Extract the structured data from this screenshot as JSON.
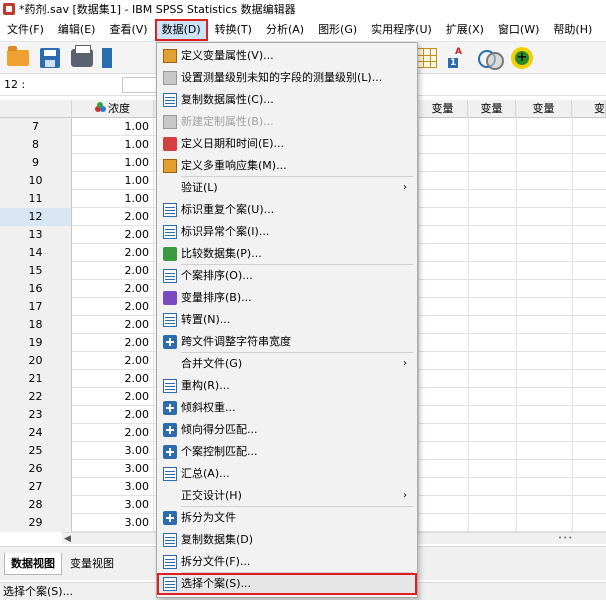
{
  "window": {
    "title": "*药剂.sav [数据集1] - IBM SPSS Statistics 数据编辑器",
    "app_icon": "spss-app-icon"
  },
  "menubar": [
    {
      "label": "文件(F)"
    },
    {
      "label": "编辑(E)"
    },
    {
      "label": "查看(V)"
    },
    {
      "label": "数据(D)",
      "active": true
    },
    {
      "label": "转换(T)"
    },
    {
      "label": "分析(A)"
    },
    {
      "label": "图形(G)"
    },
    {
      "label": "实用程序(U)"
    },
    {
      "label": "扩展(X)"
    },
    {
      "label": "窗口(W)"
    },
    {
      "label": "帮助(H)"
    }
  ],
  "refbar": {
    "label": "12 :",
    "value": ""
  },
  "grid": {
    "variable": "浓度",
    "columns": [
      "变量",
      "变量",
      "变量",
      "变"
    ],
    "selected_row": "12",
    "rows": [
      {
        "n": "7",
        "v": "1.00"
      },
      {
        "n": "8",
        "v": "1.00"
      },
      {
        "n": "9",
        "v": "1.00"
      },
      {
        "n": "10",
        "v": "1.00"
      },
      {
        "n": "11",
        "v": "1.00"
      },
      {
        "n": "12",
        "v": "2.00"
      },
      {
        "n": "13",
        "v": "2.00"
      },
      {
        "n": "14",
        "v": "2.00"
      },
      {
        "n": "15",
        "v": "2.00"
      },
      {
        "n": "16",
        "v": "2.00"
      },
      {
        "n": "17",
        "v": "2.00"
      },
      {
        "n": "18",
        "v": "2.00"
      },
      {
        "n": "19",
        "v": "2.00"
      },
      {
        "n": "20",
        "v": "2.00"
      },
      {
        "n": "21",
        "v": "2.00"
      },
      {
        "n": "22",
        "v": "2.00"
      },
      {
        "n": "23",
        "v": "2.00"
      },
      {
        "n": "24",
        "v": "2.00"
      },
      {
        "n": "25",
        "v": "3.00"
      },
      {
        "n": "26",
        "v": "3.00"
      },
      {
        "n": "27",
        "v": "3.00"
      },
      {
        "n": "28",
        "v": "3.00"
      },
      {
        "n": "29",
        "v": "3.00"
      }
    ]
  },
  "tabs": {
    "data_view": "数据视图",
    "variable_view": "变量视图"
  },
  "status": "选择个案(S)...",
  "data_menu": {
    "items": [
      {
        "label": "定义变量属性(V)...",
        "icon": "define-variable-properties-icon",
        "type": "orange"
      },
      {
        "label": "设置测量级别未知的字段的测量级别(L)...",
        "icon": "measurement-level-icon",
        "type": "gray"
      },
      {
        "label": "复制数据属性(C)...",
        "icon": "copy-data-properties-icon",
        "type": "sheet"
      },
      {
        "label": "新建定制属性(B)...",
        "icon": "custom-attribute-icon",
        "type": "gray",
        "disabled": true
      },
      {
        "label": "定义日期和时间(E)...",
        "icon": "date-time-icon",
        "type": "red"
      },
      {
        "label": "定义多重响应集(M)...",
        "icon": "multiple-response-icon",
        "type": "orange"
      },
      {
        "label": "验证(L)",
        "icon": "",
        "type": "none",
        "submenu": true
      },
      {
        "label": "标识重复个案(U)...",
        "icon": "duplicate-cases-icon",
        "type": "sheet"
      },
      {
        "label": "标识异常个案(I)...",
        "icon": "unusual-cases-icon",
        "type": "sheet"
      },
      {
        "label": "比较数据集(P)...",
        "icon": "compare-datasets-icon",
        "type": "green"
      },
      {
        "label": "个案排序(O)...",
        "icon": "sort-cases-icon",
        "type": "sheet"
      },
      {
        "label": "变量排序(B)...",
        "icon": "sort-variables-icon",
        "type": "purple"
      },
      {
        "label": "转置(N)...",
        "icon": "transpose-icon",
        "type": "sheet"
      },
      {
        "label": "跨文件调整字符串宽度",
        "icon": "string-width-icon",
        "type": "blueplus"
      },
      {
        "label": "合并文件(G)",
        "icon": "",
        "type": "none",
        "submenu": true
      },
      {
        "label": "重构(R)...",
        "icon": "restructure-icon",
        "type": "sheet"
      },
      {
        "label": "倾斜权重...",
        "icon": "rake-weights-icon",
        "type": "blueplus"
      },
      {
        "label": "倾向得分匹配...",
        "icon": "propensity-matching-icon",
        "type": "blueplus"
      },
      {
        "label": "个案控制匹配...",
        "icon": "case-control-icon",
        "type": "blueplus"
      },
      {
        "label": "汇总(A)...",
        "icon": "aggregate-icon",
        "type": "sheet"
      },
      {
        "label": "正交设计(H)",
        "icon": "",
        "type": "none",
        "submenu": true
      },
      {
        "label": "拆分为文件",
        "icon": "split-into-files-icon",
        "type": "blueplus"
      },
      {
        "label": "复制数据集(D)",
        "icon": "copy-dataset-icon",
        "type": "sheet"
      },
      {
        "label": "拆分文件(F)...",
        "icon": "split-file-icon",
        "type": "sheet"
      },
      {
        "label": "选择个案(S)...",
        "icon": "select-cases-icon",
        "type": "sheet",
        "highlighted": true
      }
    ],
    "submenu_arrow": "›"
  },
  "colors": {
    "highlight_outline": "#e02020",
    "menu_active_bg": "#cce4f7",
    "accent_blue": "#2b6cb0"
  }
}
